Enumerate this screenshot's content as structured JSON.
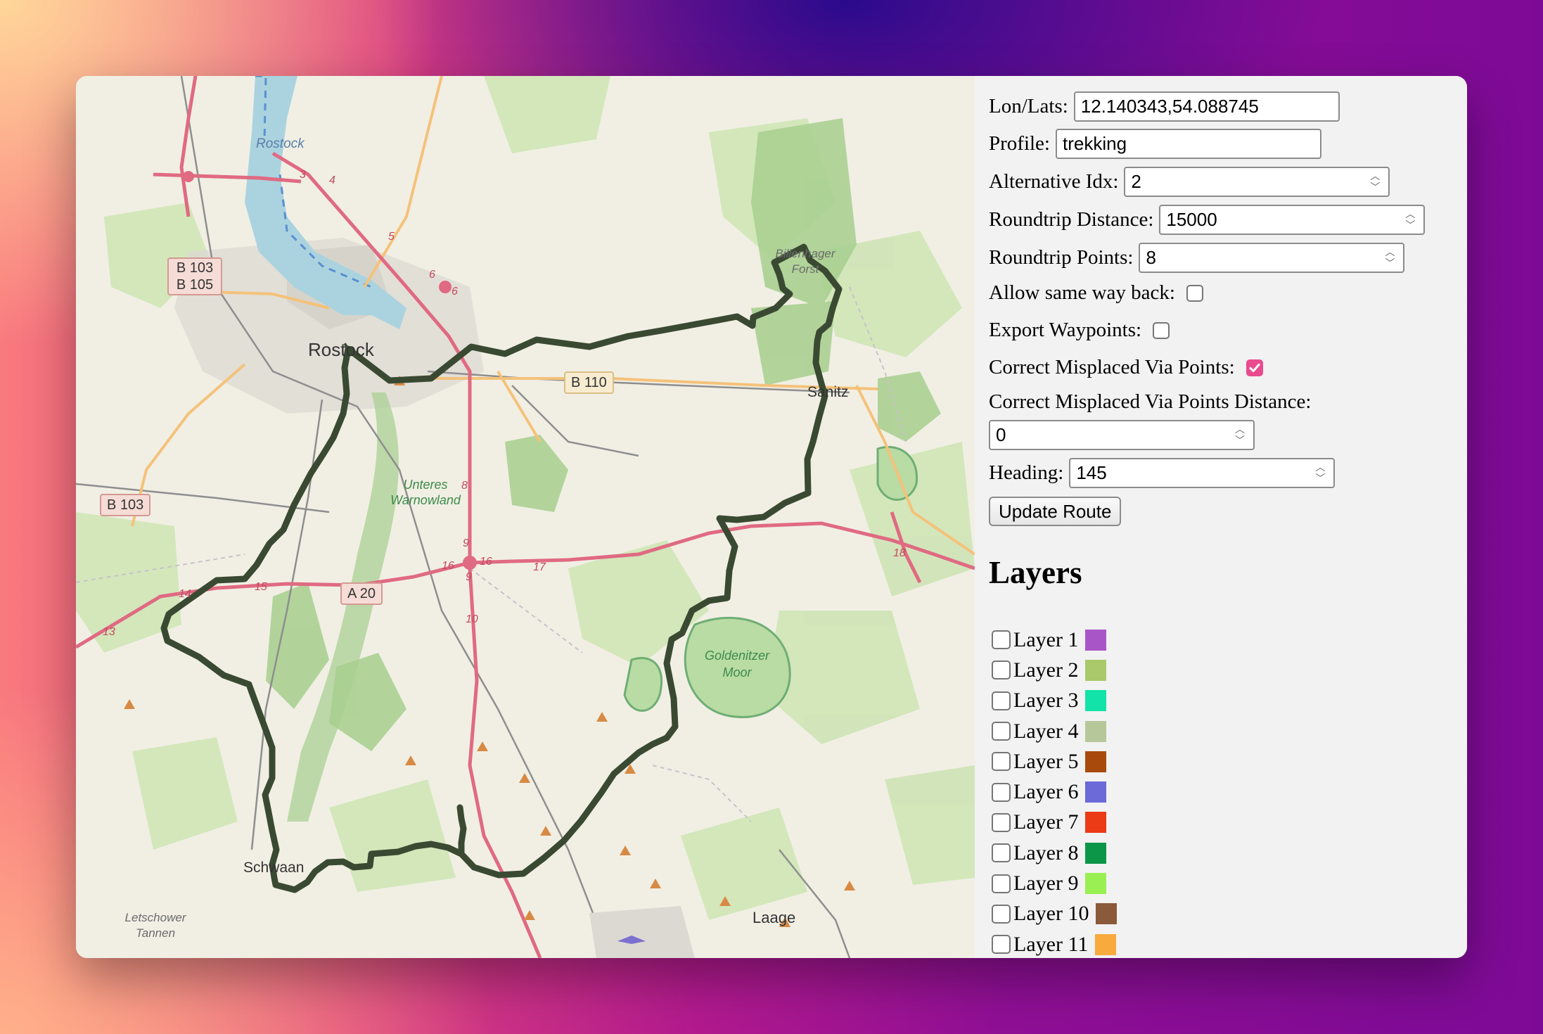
{
  "map": {
    "place_labels": [
      "Rostock",
      "Rostock",
      "Sanitz",
      "Schwaan",
      "Laage",
      "Unteres Warnowland",
      "Goldenitzer Moor",
      "Letschower Tannen",
      "Billenhager Forst"
    ],
    "road_labels": [
      "B 103 B 105",
      "B 110",
      "B 103",
      "A 20"
    ],
    "junction_numbers": [
      "3",
      "4",
      "5",
      "6",
      "6",
      "8",
      "9",
      "9",
      "10",
      "13",
      "14",
      "15",
      "16",
      "16",
      "17",
      "18"
    ]
  },
  "form": {
    "lonlats_label": "Lon/Lats:",
    "lonlats_value": "12.140343,54.088745",
    "profile_label": "Profile:",
    "profile_value": "trekking",
    "alt_idx_label": "Alternative Idx:",
    "alt_idx_value": "2",
    "rt_distance_label": "Roundtrip Distance:",
    "rt_distance_value": "15000",
    "rt_points_label": "Roundtrip Points:",
    "rt_points_value": "8",
    "same_way_label": "Allow same way back:",
    "same_way_checked": false,
    "export_wp_label": "Export Waypoints:",
    "export_wp_checked": false,
    "correct_via_label": "Correct Misplaced Via Points:",
    "correct_via_checked": true,
    "correct_via_dist_label": "Correct Misplaced Via Points Distance:",
    "correct_via_dist_value": "0",
    "heading_label": "Heading:",
    "heading_value": "145",
    "update_button": "Update Route"
  },
  "layers": {
    "title": "Layers",
    "items": [
      {
        "label": "Layer 1",
        "color": "#a855c8"
      },
      {
        "label": "Layer 2",
        "color": "#a9c96a"
      },
      {
        "label": "Layer 3",
        "color": "#12e3a8"
      },
      {
        "label": "Layer 4",
        "color": "#b6c79a"
      },
      {
        "label": "Layer 5",
        "color": "#a84a0c"
      },
      {
        "label": "Layer 6",
        "color": "#6c69d8"
      },
      {
        "label": "Layer 7",
        "color": "#ea3a16"
      },
      {
        "label": "Layer 8",
        "color": "#0c9648"
      },
      {
        "label": "Layer 9",
        "color": "#9aef52"
      },
      {
        "label": "Layer 10",
        "color": "#8a5a3a"
      },
      {
        "label": "Layer 11",
        "color": "#f8aa3c"
      }
    ]
  }
}
